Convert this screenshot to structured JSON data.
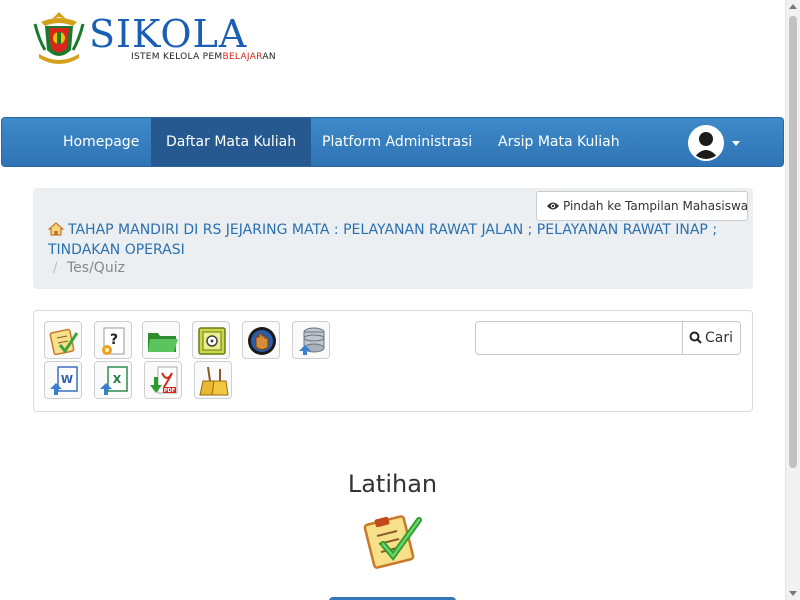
{
  "logo": {
    "wordmark": "SIKOLA",
    "tagline_pre": "ISTEM KELOLA PEM",
    "tagline_red": "BELAJAR",
    "tagline_post": "AN"
  },
  "nav": {
    "items": [
      {
        "label": "Homepage"
      },
      {
        "label": "Daftar Mata Kuliah",
        "active": true
      },
      {
        "label": "Platform Administrasi"
      },
      {
        "label": "Arsip Mata Kuliah"
      }
    ],
    "avatar_icon": "user-avatar-icon",
    "dropdown_icon": "caret-down-icon"
  },
  "breadcrumb": {
    "switch_view_label": "Pindah ke Tampilan Mahasiswa",
    "course": "TAHAP MANDIRI DI RS JEJARING MATA : PELAYANAN RAWAT JALAN ; PELAYANAN RAWAT INAP ; TINDAKAN OPERASI",
    "separator": "/",
    "current": "Tes/Quiz"
  },
  "toolbar": {
    "icons": [
      "quiz-checklist-icon",
      "question-icon",
      "folder-icon",
      "safe-icon",
      "hand-icon",
      "database-upload-icon",
      "word-upload-icon",
      "excel-upload-icon",
      "pdf-download-icon",
      "broom-icon"
    ],
    "search_placeholder": "",
    "search_button": "Cari"
  },
  "section": {
    "title": "Latihan",
    "icon": "quiz-checklist-icon"
  },
  "colors": {
    "navbar": "#2f74b5",
    "navbar_active": "#25598f",
    "brand_blue": "#1a5fb4",
    "brand_red": "#d9261c"
  }
}
